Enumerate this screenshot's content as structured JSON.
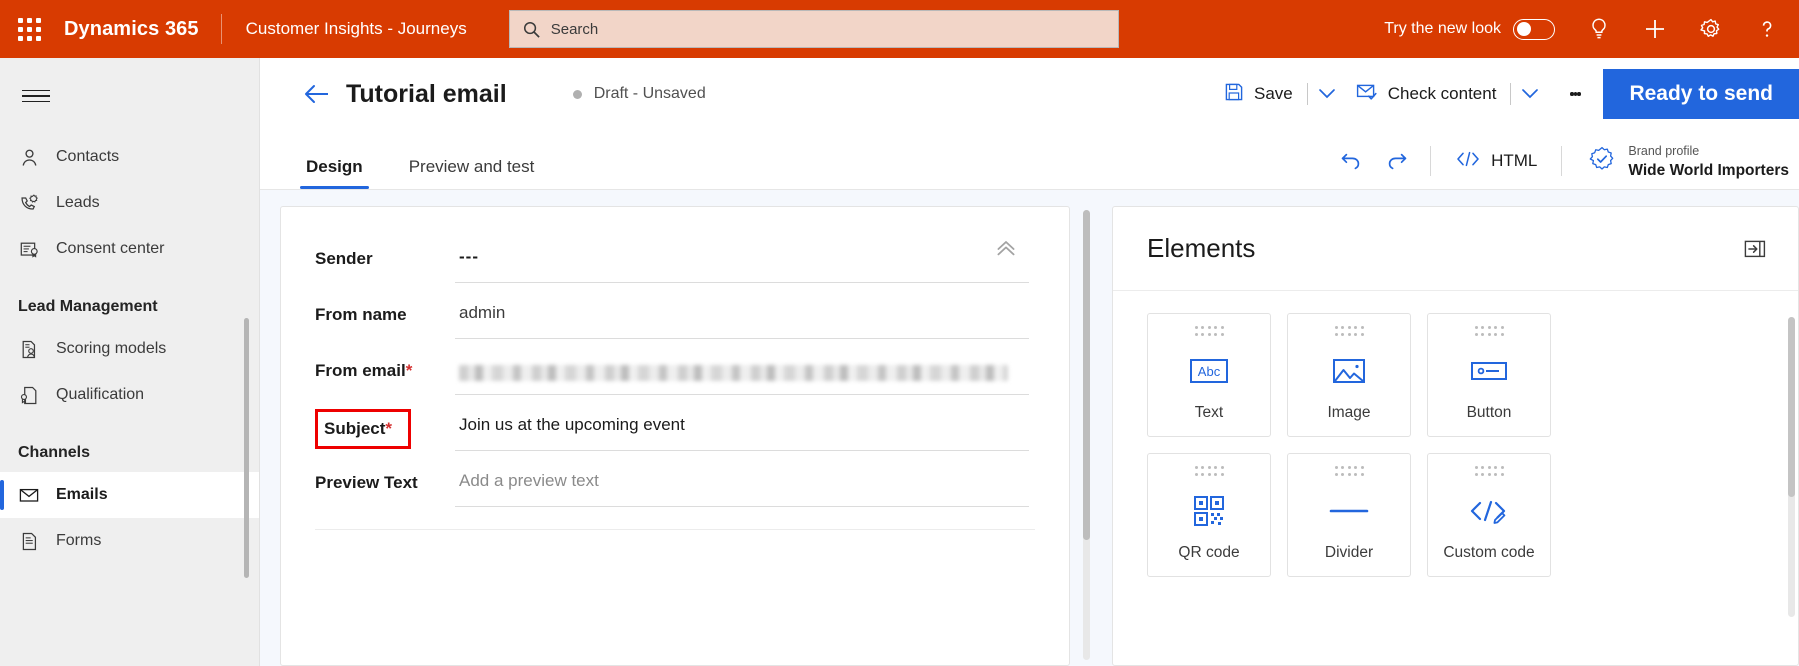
{
  "topbar": {
    "waffle_icon": "app-launcher-icon",
    "brand": "Dynamics 365",
    "app_name": "Customer Insights - Journeys",
    "search": {
      "placeholder": "Search",
      "icon": "search-icon"
    },
    "new_look_label": "Try the new look",
    "new_look_on": true,
    "icons": [
      "lightbulb-icon",
      "plus-icon",
      "gear-icon",
      "help-icon"
    ],
    "bg_color": "#d83b01",
    "search_bg": "#f2d5c8"
  },
  "sidebar": {
    "hamburger_icon": "hamburger-icon",
    "items": [
      {
        "label": "Contacts",
        "icon": "contact-icon",
        "selected": false
      },
      {
        "label": "Leads",
        "icon": "leads-icon",
        "selected": false
      },
      {
        "label": "Consent center",
        "icon": "consent-center-icon",
        "selected": false
      }
    ],
    "groups": [
      {
        "title": "Lead Management",
        "items": [
          {
            "label": "Scoring models",
            "icon": "scoring-models-icon",
            "selected": false
          },
          {
            "label": "Qualification",
            "icon": "qualification-icon",
            "selected": false
          }
        ]
      },
      {
        "title": "Channels",
        "items": [
          {
            "label": "Emails",
            "icon": "email-icon",
            "selected": true
          },
          {
            "label": "Forms",
            "icon": "forms-icon",
            "selected": false
          }
        ]
      }
    ],
    "selected_accent": "#2266dd"
  },
  "command_bar": {
    "back_icon": "back-arrow-icon",
    "title": "Tutorial email",
    "status": "Draft - Unsaved",
    "status_dot_color": "#b0b0b0",
    "save_label": "Save",
    "save_icon": "save-icon",
    "check_content_label": "Check content",
    "check_content_icon": "envelope-check-icon",
    "overflow_icon": "more-vertical-icon",
    "primary_label": "Ready to send",
    "primary_color": "#2266dd"
  },
  "tabs": [
    {
      "label": "Design",
      "active": true
    },
    {
      "label": "Preview and test",
      "active": false
    }
  ],
  "tab_tools": {
    "undo_icon": "undo-icon",
    "redo_icon": "redo-icon",
    "html_label": "HTML",
    "html_icon": "code-icon",
    "brand_profile_label": "Brand profile",
    "brand_profile_name": "Wide World Importers",
    "brand_profile_icon": "brand-badge-icon"
  },
  "canvas": {
    "collapse_icon": "chevron-double-up-icon",
    "fields": [
      {
        "name": "sender",
        "label": "Sender",
        "required": false,
        "value": "---",
        "placeholder": "",
        "highlighted": false,
        "style": "dashes"
      },
      {
        "name": "from-name",
        "label": "From name",
        "required": false,
        "value": "admin",
        "placeholder": "",
        "highlighted": false,
        "style": "text"
      },
      {
        "name": "from-email",
        "label": "From email",
        "required": true,
        "value": "",
        "placeholder": "",
        "highlighted": false,
        "style": "blurred"
      },
      {
        "name": "subject",
        "label": "Subject",
        "required": true,
        "value": "Join us at the upcoming event",
        "placeholder": "",
        "highlighted": true,
        "style": "text"
      },
      {
        "name": "preview-text",
        "label": "Preview Text",
        "required": false,
        "value": "",
        "placeholder": "Add a preview text",
        "highlighted": false,
        "style": "placeholder"
      }
    ],
    "highlight_color": "#ee0000"
  },
  "elements_panel": {
    "title": "Elements",
    "collapse_icon": "collapse-panel-icon",
    "items": [
      {
        "label": "Text",
        "icon": "text-abc-icon"
      },
      {
        "label": "Image",
        "icon": "image-icon"
      },
      {
        "label": "Button",
        "icon": "button-icon"
      },
      {
        "label": "QR code",
        "icon": "qr-code-icon"
      },
      {
        "label": "Divider",
        "icon": "divider-icon"
      },
      {
        "label": "Custom code",
        "icon": "custom-code-icon"
      }
    ],
    "accent": "#2266dd"
  }
}
